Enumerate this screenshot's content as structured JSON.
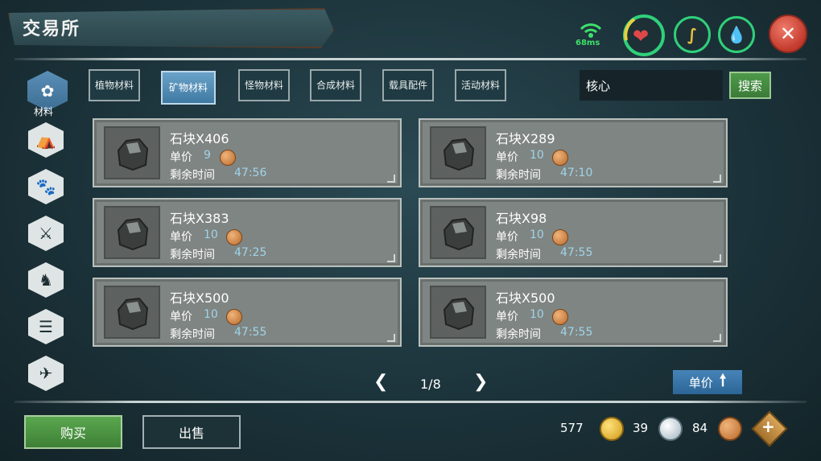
{
  "header": {
    "title": "交易所",
    "ping": "68ms"
  },
  "status": {
    "heart_icon": "heart-icon",
    "stamina_icon": "stamina-icon",
    "water_icon": "water-drop-icon",
    "accent_green": "#2fd07a",
    "close_color": "#d04433"
  },
  "sidebar": {
    "items": [
      {
        "label": "材料",
        "icon": "materials-icon",
        "active": true
      },
      {
        "label": "",
        "icon": "camp-icon"
      },
      {
        "label": "",
        "icon": "paw-icon"
      },
      {
        "label": "",
        "icon": "weapon-icon"
      },
      {
        "label": "",
        "icon": "horse-icon"
      },
      {
        "label": "",
        "icon": "furniture-icon"
      },
      {
        "label": "",
        "icon": "glider-icon"
      }
    ]
  },
  "tabs": [
    {
      "label": "植物材料",
      "active": false
    },
    {
      "label": "矿物材料",
      "active": true
    },
    {
      "label": "怪物材料",
      "active": false
    },
    {
      "label": "合成材料",
      "active": false
    },
    {
      "label": "载具配件",
      "active": false
    },
    {
      "label": "活动材料",
      "active": false
    }
  ],
  "search": {
    "value": "核心",
    "button": "搜索"
  },
  "listings": {
    "price_label": "单价",
    "time_label": "剩余时间",
    "items": [
      {
        "name": "石块X406",
        "price": "9",
        "time": "47:56"
      },
      {
        "name": "石块X289",
        "price": "10",
        "time": "47:10"
      },
      {
        "name": "石块X383",
        "price": "10",
        "time": "47:25"
      },
      {
        "name": "石块X98",
        "price": "10",
        "time": "47:55"
      },
      {
        "name": "石块X500",
        "price": "10",
        "time": "47:55"
      },
      {
        "name": "石块X500",
        "price": "10",
        "time": "47:55"
      }
    ]
  },
  "pager": {
    "page": "1/8"
  },
  "sort": {
    "label": "单价"
  },
  "actions": {
    "buy": "购买",
    "sell": "出售"
  },
  "currency": {
    "gold": "577",
    "silver": "39",
    "bronze": "84"
  }
}
